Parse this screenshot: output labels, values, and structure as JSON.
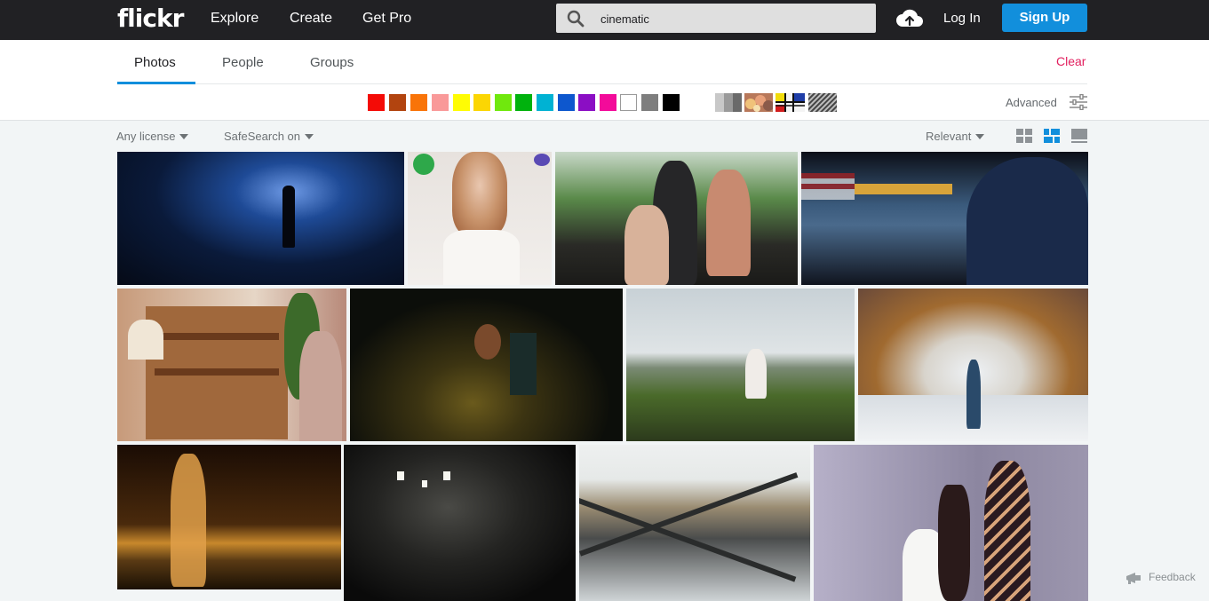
{
  "nav": {
    "logo": "flickr",
    "explore": "Explore",
    "create": "Create",
    "get_pro": "Get Pro",
    "login": "Log In",
    "signup": "Sign Up"
  },
  "search": {
    "value": "cinematic"
  },
  "tabs": [
    {
      "label": "Photos",
      "active": true
    },
    {
      "label": "People",
      "active": false
    },
    {
      "label": "Groups",
      "active": false
    }
  ],
  "clear": "Clear",
  "colors": [
    "#f40b06",
    "#b2440f",
    "#f97408",
    "#f99999",
    "#fffc04",
    "#fbd603",
    "#70e80d",
    "#00b20d",
    "#00b2d3",
    "#0d57ce",
    "#8b0ec4",
    "#f30b9a",
    "#ffffff",
    "#7e7e7e",
    "#000000"
  ],
  "style_filters": [
    "black-and-white",
    "shallow-depth-of-field",
    "minimalist",
    "patterns"
  ],
  "advanced": "Advanced",
  "filters": {
    "license": "Any license",
    "safesearch": "SafeSearch on",
    "sort": "Relevant"
  },
  "view_modes": [
    "grid-small-icon",
    "grid-justified-icon",
    "grid-large-icon"
  ],
  "photos": [
    {
      "name": "warehouse-guitarist",
      "colors": [
        "#0a1a3a",
        "#1e4a96",
        "#0a1024"
      ]
    },
    {
      "name": "doll-portrait",
      "colors": [
        "#e7e2de",
        "#c8936b",
        "#f4f2ef"
      ]
    },
    {
      "name": "scooter-riders",
      "colors": [
        "#4a6a3a",
        "#2a2a26",
        "#c88a70"
      ]
    },
    {
      "name": "subway-blur",
      "colors": [
        "#10141e",
        "#4a6a8c",
        "#1a2a4a"
      ]
    },
    {
      "name": "vintage-hutch",
      "colors": [
        "#c79a7a",
        "#a0683c",
        "#e6d6c6"
      ]
    },
    {
      "name": "church-candles",
      "colors": [
        "#0a0b08",
        "#3c3412",
        "#0c0e0a"
      ]
    },
    {
      "name": "coastal-meadow",
      "colors": [
        "#c8d1d6",
        "#4a6a2a",
        "#2c3a1c"
      ]
    },
    {
      "name": "mosaic-metro",
      "colors": [
        "#d8d4cc",
        "#a06a30",
        "#eef2f6"
      ]
    },
    {
      "name": "golden-tree",
      "colors": [
        "#4a2a0c",
        "#c8882c",
        "#1a0c04"
      ]
    },
    {
      "name": "escalator-tunnel",
      "colors": [
        "#141414",
        "#4a4a46",
        "#0a0a0a"
      ]
    },
    {
      "name": "steel-lattice",
      "colors": [
        "#e6e9e8",
        "#4a4c4c",
        "#9a8c72"
      ]
    },
    {
      "name": "wall-duo",
      "colors": [
        "#8c86a0",
        "#4a3a48",
        "#b6b0c8"
      ]
    }
  ],
  "feedback": "Feedback"
}
